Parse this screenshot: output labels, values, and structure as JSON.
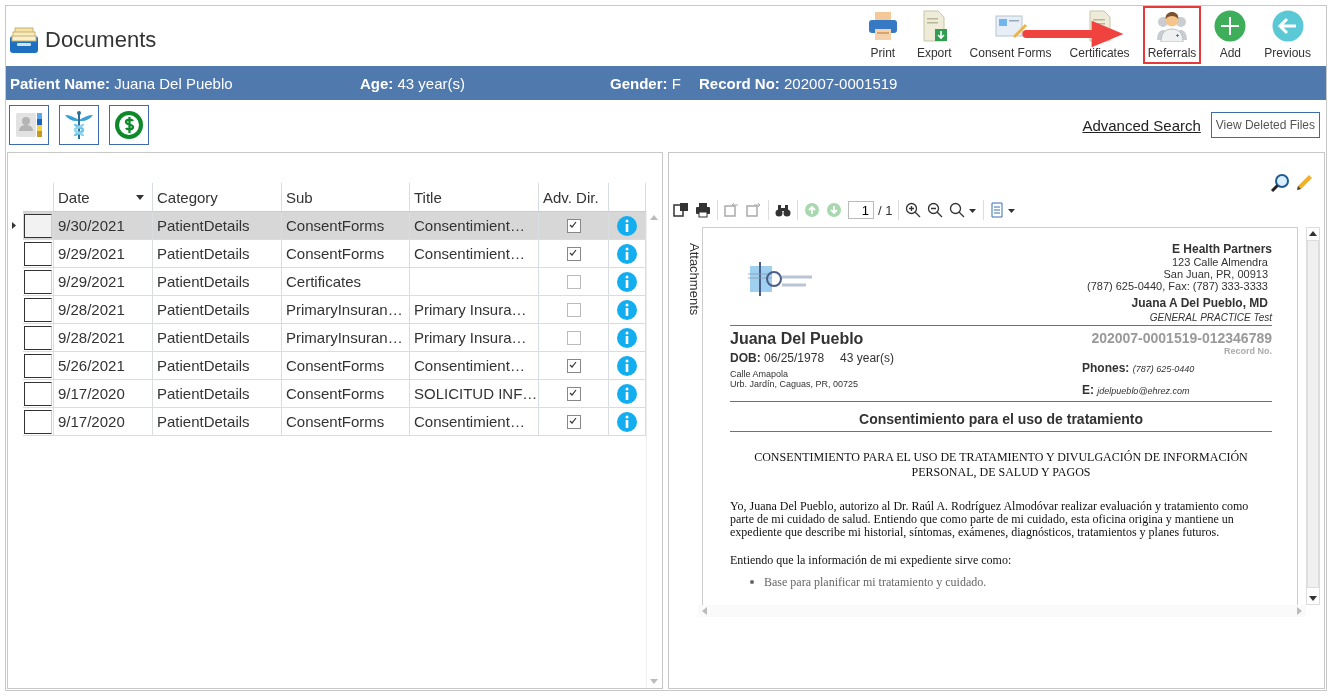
{
  "header": {
    "title": "Documents"
  },
  "toolbar": [
    {
      "kind": "print",
      "label": "Print",
      "highlighted": false
    },
    {
      "kind": "export",
      "label": "Export",
      "highlighted": false
    },
    {
      "kind": "consent",
      "label": "Consent Forms",
      "highlighted": false
    },
    {
      "kind": "certificate",
      "label": "Certificates",
      "highlighted": false
    },
    {
      "kind": "referral",
      "label": "Referrals",
      "highlighted": true
    },
    {
      "kind": "add",
      "label": "Add",
      "highlighted": false
    },
    {
      "kind": "previous",
      "label": "Previous",
      "highlighted": false
    }
  ],
  "patient_bar": [
    {
      "label": "Patient Name:",
      "value": "Juana Del Pueblo"
    },
    {
      "label": "Age:",
      "value": "43 year(s)"
    },
    {
      "label": "Gender:",
      "value": "F"
    },
    {
      "label": "Record No:",
      "value": "202007-0001519"
    }
  ],
  "links": {
    "advanced_search": "Advanced Search",
    "view_deleted": "View Deleted Files"
  },
  "table": {
    "columns": [
      {
        "label": "Date",
        "sorted": true
      },
      {
        "label": "Category",
        "sorted": false
      },
      {
        "label": "Sub",
        "sorted": false
      },
      {
        "label": "Title",
        "sorted": false
      },
      {
        "label": "Adv. Dir.",
        "sorted": false
      }
    ],
    "rows": [
      {
        "date": "9/30/2021",
        "category": "PatientDetails",
        "sub": "ConsentForms",
        "title": "Consentimient…",
        "adv_dir": true,
        "selected": true
      },
      {
        "date": "9/29/2021",
        "category": "PatientDetails",
        "sub": "ConsentForms",
        "title": "Consentimient…",
        "adv_dir": true,
        "selected": false
      },
      {
        "date": "9/29/2021",
        "category": "PatientDetails",
        "sub": "Certificates",
        "title": "",
        "adv_dir": false,
        "selected": false
      },
      {
        "date": "9/28/2021",
        "category": "PatientDetails",
        "sub": "PrimaryInsuran…",
        "title": "Primary Insura…",
        "adv_dir": false,
        "selected": false
      },
      {
        "date": "9/28/2021",
        "category": "PatientDetails",
        "sub": "PrimaryInsuran…",
        "title": "Primary Insura…",
        "adv_dir": false,
        "selected": false
      },
      {
        "date": "5/26/2021",
        "category": "PatientDetails",
        "sub": "ConsentForms",
        "title": "Consentimient…",
        "adv_dir": true,
        "selected": false
      },
      {
        "date": "9/17/2020",
        "category": "PatientDetails",
        "sub": "ConsentForms",
        "title": "SOLICITUD INF…",
        "adv_dir": true,
        "selected": false
      },
      {
        "date": "9/17/2020",
        "category": "PatientDetails",
        "sub": "ConsentForms",
        "title": "Consentimient…",
        "adv_dir": true,
        "selected": false
      }
    ]
  },
  "viewer": {
    "page": "1",
    "page_total": "/ 1",
    "side_tab": "Attachments",
    "document": {
      "org_name": "E Health Partners",
      "org_address": [
        "123 Calle Almendra",
        "San Juan, PR, 00913",
        "(787) 625-0440, Fax: (787) 333-3333"
      ],
      "doctor": "Juana A Del Pueblo, MD",
      "specialty": "GENERAL PRACTICE Test",
      "patient_name": "Juana Del Pueblo",
      "dob_label": "DOB:",
      "dob": "06/25/1978",
      "age": "43 year(s)",
      "patient_address": [
        "Calle Amapola",
        "Urb. Jardín, Caguas, PR, 00725"
      ],
      "record_no": "202007-0001519-012346789",
      "record_label": "Record No.",
      "phones_label": "Phones:",
      "phones": "(787) 625-0440",
      "email_label": "E:",
      "email": "jdelpueblo@ehrez.com",
      "heading": "Consentimiento para el uso de tratamiento",
      "title": "CONSENTIMIENTO PARA EL USO DE TRATAMIENTO Y DIVULGACIÓN DE INFORMACIÓN PERSONAL, DE SALUD Y PAGOS",
      "paragraphs": [
        "Yo, Juana Del Pueblo, autorizo al Dr. Raúl A. Rodríguez Almodóvar realizar evaluación y tratamiento como parte de mi cuidado de salud.  Entiendo que como parte de mi cuidado, esta oficina origina y mantiene un expediente que describe mi historial, síntomas, exámenes, diagnósticos, tratamientos y planes futuros.",
        "Entiendo que la información de mi expediente sirve como:"
      ],
      "bullets": [
        "Base para planificar mi tratamiento y cuidado."
      ]
    }
  }
}
